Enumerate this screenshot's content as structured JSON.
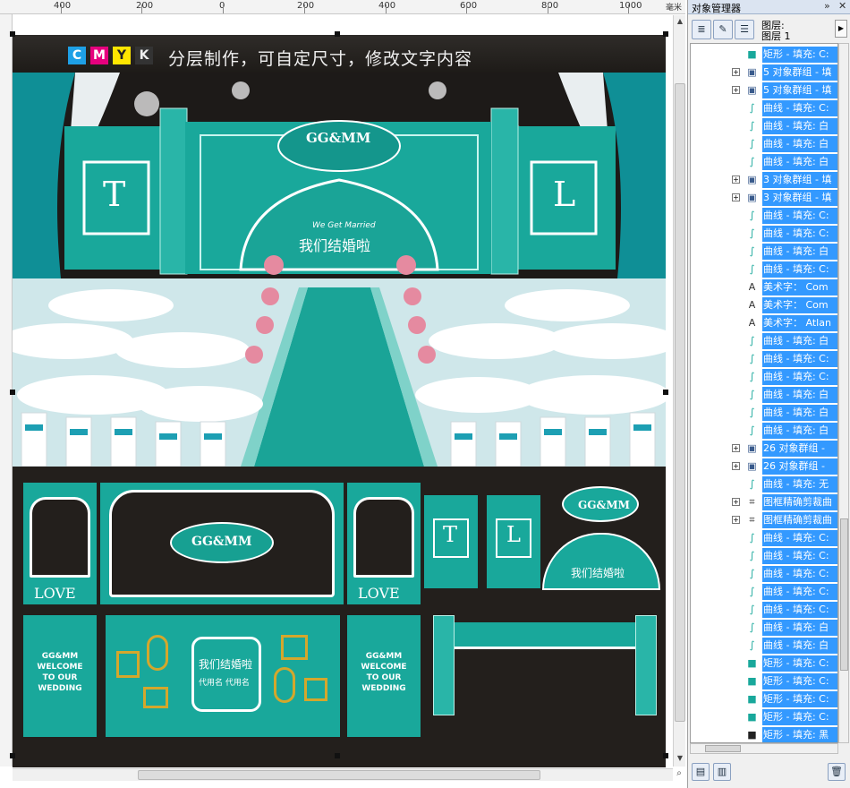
{
  "ruler": {
    "labels": [
      "400",
      "200",
      "0",
      "200",
      "400",
      "600",
      "800",
      "1000"
    ],
    "unit": "毫米"
  },
  "design": {
    "cmyk_letters": [
      "C",
      "M",
      "Y",
      "K"
    ],
    "cmyk_colors": [
      "#1ea0e6",
      "#e6007e",
      "#ffe600",
      "#333333"
    ],
    "banner_text": "分层制作，可自定尺寸，修改文字内容",
    "monogram": "GG&MM",
    "letter_left": "T",
    "letter_right": "L",
    "married_text": "我们结婚啦",
    "married_script": "We Get Married",
    "love_text": "LOVE",
    "welcome_text": "GG&MM WELCOME TO OUR WEDDING",
    "names_text": "代用名  代用名",
    "colors": {
      "teal": "#19a89b",
      "teal_dark": "#0e7f80",
      "stage_bg": "#231f1c",
      "selection": "#3399ff"
    }
  },
  "panel": {
    "title": "对象管理器",
    "layer_header_1": "图层:",
    "layer_header_2": "图层 1",
    "rows": [
      {
        "expand": false,
        "icon": "rect",
        "text": "矩形 - 填充: C:"
      },
      {
        "expand": true,
        "icon": "group",
        "text": "5 对象群组 - 填"
      },
      {
        "expand": true,
        "icon": "group",
        "text": "5 对象群组 - 填"
      },
      {
        "expand": false,
        "icon": "curve",
        "text": "曲线 - 填充: C:"
      },
      {
        "expand": false,
        "icon": "curve",
        "text": "曲线 - 填充: 白"
      },
      {
        "expand": false,
        "icon": "curve",
        "text": "曲线 - 填充: 白"
      },
      {
        "expand": false,
        "icon": "curve",
        "text": "曲线 - 填充: 白"
      },
      {
        "expand": true,
        "icon": "group",
        "text": "3 对象群组 - 填"
      },
      {
        "expand": true,
        "icon": "group",
        "text": "3 对象群组 - 填"
      },
      {
        "expand": false,
        "icon": "curve",
        "text": "曲线 - 填充: C:"
      },
      {
        "expand": false,
        "icon": "curve",
        "text": "曲线 - 填充: C:"
      },
      {
        "expand": false,
        "icon": "curve",
        "text": "曲线 - 填充: 白"
      },
      {
        "expand": false,
        "icon": "curve",
        "text": "曲线 - 填充: C:"
      },
      {
        "expand": false,
        "icon": "text",
        "text": "美术字： Com"
      },
      {
        "expand": false,
        "icon": "text",
        "text": "美术字： Com"
      },
      {
        "expand": false,
        "icon": "text",
        "text": "美术字： Atlan"
      },
      {
        "expand": false,
        "icon": "curve",
        "text": "曲线 - 填充: 白"
      },
      {
        "expand": false,
        "icon": "curve",
        "text": "曲线 - 填充: C:"
      },
      {
        "expand": false,
        "icon": "curve",
        "text": "曲线 - 填充: C:"
      },
      {
        "expand": false,
        "icon": "curve",
        "text": "曲线 - 填充: 白"
      },
      {
        "expand": false,
        "icon": "curve",
        "text": "曲线 - 填充: 白"
      },
      {
        "expand": false,
        "icon": "curve",
        "text": "曲线 - 填充: 白"
      },
      {
        "expand": true,
        "icon": "group",
        "text": "26 对象群组 -"
      },
      {
        "expand": true,
        "icon": "group",
        "text": "26 对象群组 -"
      },
      {
        "expand": false,
        "icon": "curve",
        "text": "曲线 - 填充: 无"
      },
      {
        "expand": true,
        "icon": "clip",
        "text": "图框精确剪裁曲"
      },
      {
        "expand": true,
        "icon": "clip",
        "text": "图框精确剪裁曲"
      },
      {
        "expand": false,
        "icon": "curve",
        "text": "曲线 - 填充: C:"
      },
      {
        "expand": false,
        "icon": "curve",
        "text": "曲线 - 填充: C:"
      },
      {
        "expand": false,
        "icon": "curve",
        "text": "曲线 - 填充: C:"
      },
      {
        "expand": false,
        "icon": "curve",
        "text": "曲线 - 填充: C:"
      },
      {
        "expand": false,
        "icon": "curve",
        "text": "曲线 - 填充: C:"
      },
      {
        "expand": false,
        "icon": "curve",
        "text": "曲线 - 填充: 白"
      },
      {
        "expand": false,
        "icon": "curve",
        "text": "曲线 - 填充: 白"
      },
      {
        "expand": false,
        "icon": "rect",
        "text": "矩形 - 填充: C:"
      },
      {
        "expand": false,
        "icon": "rect",
        "text": "矩形 - 填充: C:"
      },
      {
        "expand": false,
        "icon": "rect",
        "text": "矩形 - 填充: C:"
      },
      {
        "expand": false,
        "icon": "rect",
        "text": "矩形 - 填充: C:"
      },
      {
        "expand": false,
        "icon": "rect-black",
        "text": "矩形 - 填充: 黑"
      }
    ]
  }
}
